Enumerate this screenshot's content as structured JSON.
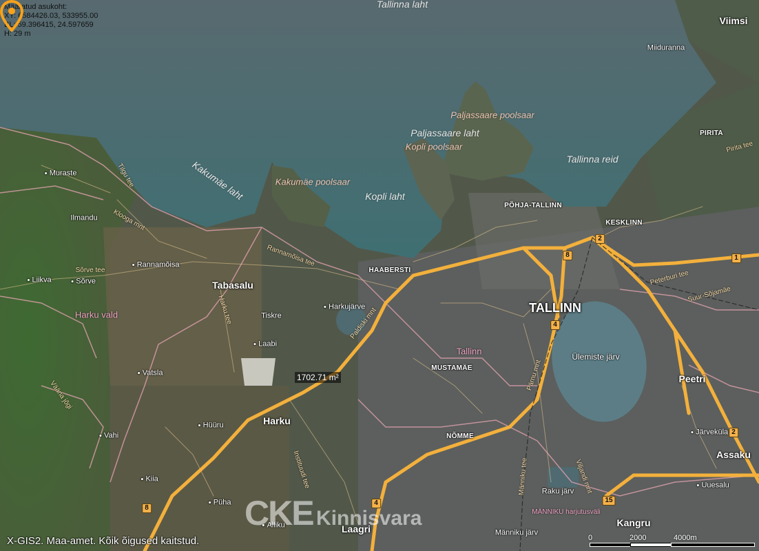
{
  "coordinates": {
    "title": "Määratud asukoht:",
    "xy": "XY: 6584426.03, 533955.00",
    "bl": "BL: 59.396415, 24.597659",
    "h": "H: 29 m"
  },
  "measurement": {
    "area": "1702.71 m²",
    "marker_icon": "location-pin"
  },
  "water_labels": [
    "Tallinna laht",
    "Kakumäe laht",
    "Paljassaare laht",
    "Kopli laht",
    "Tallinna reid"
  ],
  "peninsula_labels": [
    "Paljassaare poolsaar",
    "Kopli poolsaar",
    "Kakumäe poolsaar"
  ],
  "district_labels": [
    "PÕHJA-TALLINN",
    "KESKLINN",
    "HAABERSTI",
    "MUSTAMÄE",
    "NÕMME",
    "PIRITA"
  ],
  "city_labels": [
    "TALLINN",
    "Tabasalu",
    "Harku",
    "Viimsi",
    "Peetri",
    "Assaku",
    "Kangru",
    "Laagri"
  ],
  "region_labels": [
    "Harku vald",
    "Tallinn",
    "Ülemiste järv"
  ],
  "village_labels": [
    "Muraste",
    "Ilmandu",
    "Rannamõisa",
    "Liikva",
    "Sõrve",
    "Tiskre",
    "Harkujärve",
    "Laabi",
    "Vatsla",
    "Vahi",
    "Hüüru",
    "Kiia",
    "Püha",
    "Alliku",
    "Miiduranna",
    "Järveküla",
    "Uuesalu",
    "Raku järv",
    "Männiku järv",
    "MÄNNIKU harjutusväli"
  ],
  "street_labels": [
    "Tilgu tee",
    "Klooga mnt",
    "Sõrve tee",
    "Rannamõisa tee",
    "Harku tee",
    "Paldiski mnt",
    "Vääna jõgi",
    "Peterburi tee",
    "Suur-Sõjamäe",
    "Pärnu mnt",
    "Männiku tee",
    "Viljandi mnt",
    "Instituudi tee",
    "Pirita tee"
  ],
  "road_numbers": [
    "2",
    "8",
    "1",
    "4",
    "2",
    "8",
    "4",
    "15"
  ],
  "copyright": "X-GIS2. Maa-amet. Kõik õigused kaitstud.",
  "scale": {
    "zero": "0",
    "mid": "2000",
    "end": "4000m"
  },
  "watermark": {
    "left": "CKE",
    "right": "Kinnisvara"
  }
}
